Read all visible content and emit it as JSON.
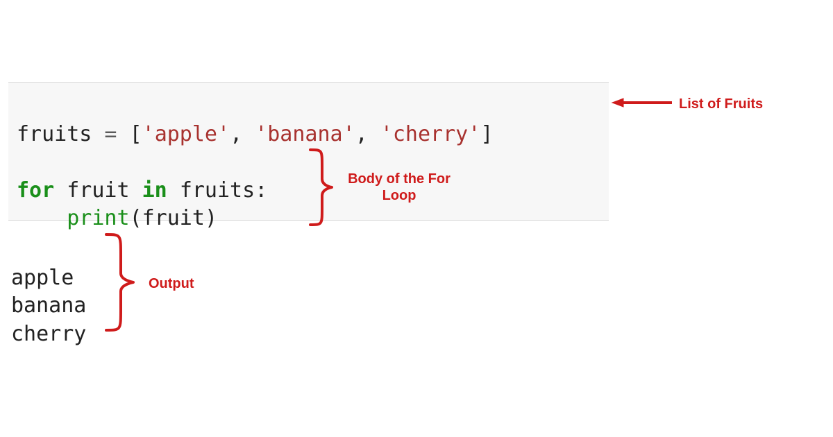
{
  "code": {
    "line1": {
      "var": "fruits",
      "eq": " = ",
      "lb": "[",
      "s1q1": "'",
      "s1": "apple",
      "s1q2": "'",
      "c1": ", ",
      "s2q1": "'",
      "s2": "banana",
      "s2q2": "'",
      "c2": ", ",
      "s3q1": "'",
      "s3": "cherry",
      "s3q2": "'",
      "rb": "]"
    },
    "blank": "",
    "line3": {
      "kw_for": "for",
      "sp1": " ",
      "iter": "fruit",
      "sp2": " ",
      "kw_in": "in",
      "sp3": " ",
      "coll": "fruits",
      "colon": ":"
    },
    "line4": {
      "indent": "    ",
      "fn": "print",
      "lp": "(",
      "arg": "fruit",
      "rp": ")"
    }
  },
  "output": {
    "l1": "apple",
    "l2": "banana",
    "l3": "cherry"
  },
  "annotations": {
    "list_label": "List of Fruits",
    "body_label_l1": "Body of the For",
    "body_label_l2": "Loop",
    "output_label": "Output"
  }
}
